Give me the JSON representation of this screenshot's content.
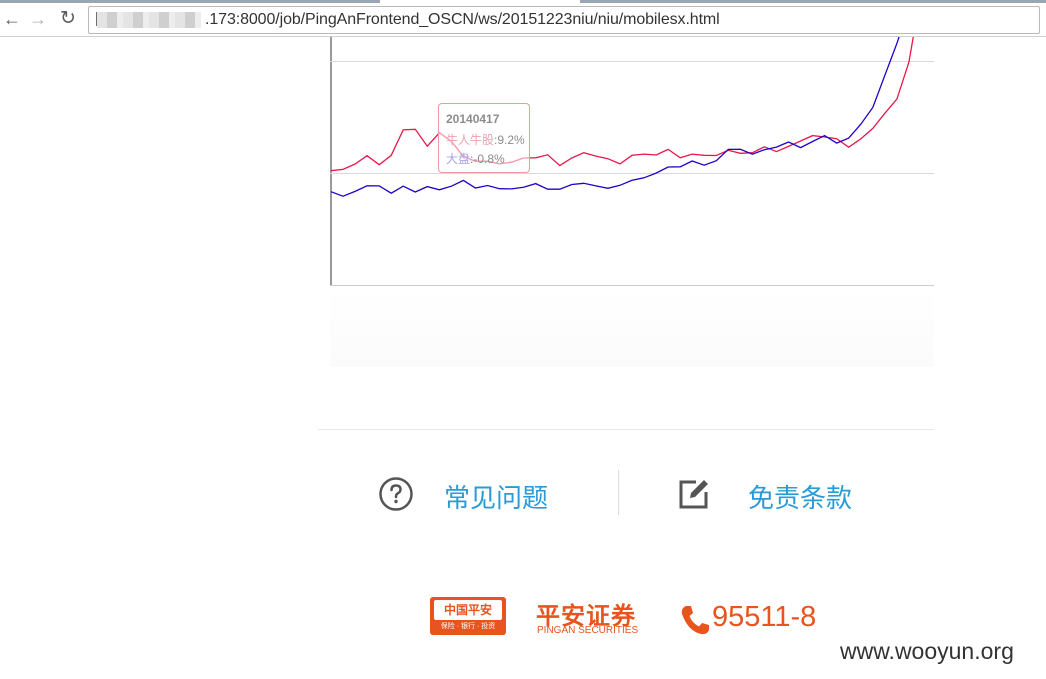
{
  "browser": {
    "url": ".173:8000/job/PingAnFrontend_OSCN/ws/20151223niu/niu/mobilesx.html",
    "url_prefix": "["
  },
  "chart_data": {
    "type": "line",
    "series": [
      {
        "name": "牛人牛股",
        "color": "#e8174a",
        "values": [
          1,
          1,
          4,
          6,
          3,
          7,
          15,
          16,
          10,
          14,
          12,
          6,
          4,
          5,
          3,
          4,
          6,
          5,
          7,
          3,
          5,
          8,
          6,
          5,
          4,
          6,
          7,
          7,
          8,
          6,
          7,
          6,
          7,
          8,
          7,
          8,
          9,
          8,
          10,
          11,
          14,
          13,
          12,
          10,
          12,
          16,
          22,
          26,
          40,
          65,
          100
        ]
      },
      {
        "name": "大盘",
        "color": "#2200cc",
        "values": [
          -7,
          -8,
          -6,
          -5,
          -4,
          -7,
          -5,
          -6,
          -5,
          -6,
          -4,
          -3,
          -5,
          -4,
          -6,
          -5,
          -5,
          -4,
          -5,
          -6,
          -4,
          -3,
          -5,
          -5,
          -4,
          -3,
          -1,
          0,
          2,
          3,
          4,
          3,
          5,
          8,
          9,
          7,
          8,
          10,
          11,
          9,
          12,
          13,
          11,
          13,
          17,
          24,
          35,
          46,
          60,
          72,
          75
        ]
      }
    ],
    "ylim": [
      -40,
      40
    ],
    "grid": true
  },
  "tooltip": {
    "date": "20140417",
    "row1_label": "牛人牛股",
    "row1_value": ":9.2%",
    "row2_label": "大盘",
    "row2_value": ":-0.8%"
  },
  "links": {
    "faq_label": "常见问题",
    "terms_label": "免责条款"
  },
  "footer": {
    "logo1_main": "中国平安",
    "logo1_sub": "保险 · 银行 · 投资",
    "logo2_cn": "平安证券",
    "logo2_en": "PINGAN SECURITIES",
    "phone": "95511-8",
    "brand_color": "#e8541e"
  },
  "watermark": "www.wooyun.org"
}
